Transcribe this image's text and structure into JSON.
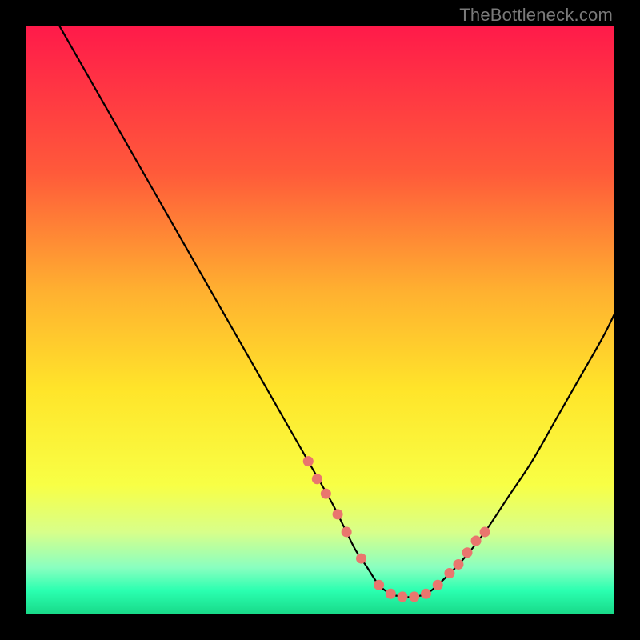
{
  "watermark": "TheBottleneck.com",
  "chart_data": {
    "type": "line",
    "title": "",
    "xlabel": "",
    "ylabel": "",
    "xlim": [
      0,
      100
    ],
    "ylim": [
      0,
      100
    ],
    "series": [
      {
        "name": "bottleneck-curve",
        "x": [
          0,
          4,
          8,
          12,
          16,
          20,
          24,
          28,
          32,
          36,
          40,
          44,
          48,
          52,
          54,
          56,
          58,
          60,
          62,
          64,
          66,
          68,
          70,
          74,
          78,
          82,
          86,
          90,
          94,
          98,
          100
        ],
        "y": [
          110,
          103,
          96,
          89,
          82,
          75,
          68,
          61,
          54,
          47,
          40,
          33,
          26,
          19,
          15,
          11,
          8,
          5,
          3.5,
          3,
          3,
          3.5,
          5,
          9,
          14,
          20,
          26,
          33,
          40,
          47,
          51
        ]
      }
    ],
    "markers": {
      "name": "highlight-dots",
      "color": "#e9766e",
      "points": [
        {
          "x": 48,
          "y": 26
        },
        {
          "x": 49.5,
          "y": 23
        },
        {
          "x": 51,
          "y": 20.5
        },
        {
          "x": 53,
          "y": 17
        },
        {
          "x": 54.5,
          "y": 14
        },
        {
          "x": 57,
          "y": 9.5
        },
        {
          "x": 60,
          "y": 5
        },
        {
          "x": 62,
          "y": 3.5
        },
        {
          "x": 64,
          "y": 3
        },
        {
          "x": 66,
          "y": 3
        },
        {
          "x": 68,
          "y": 3.5
        },
        {
          "x": 70,
          "y": 5
        },
        {
          "x": 72,
          "y": 7
        },
        {
          "x": 73.5,
          "y": 8.5
        },
        {
          "x": 75,
          "y": 10.5
        },
        {
          "x": 76.5,
          "y": 12.5
        },
        {
          "x": 78,
          "y": 14
        }
      ]
    },
    "gradient_stops": [
      {
        "offset": 0,
        "color": "#ff1a4a"
      },
      {
        "offset": 25,
        "color": "#ff5a3a"
      },
      {
        "offset": 45,
        "color": "#ffb030"
      },
      {
        "offset": 62,
        "color": "#ffe52a"
      },
      {
        "offset": 78,
        "color": "#f8ff45"
      },
      {
        "offset": 86,
        "color": "#d8ff8a"
      },
      {
        "offset": 92,
        "color": "#8affc0"
      },
      {
        "offset": 96,
        "color": "#2affb0"
      },
      {
        "offset": 100,
        "color": "#18d988"
      }
    ]
  }
}
